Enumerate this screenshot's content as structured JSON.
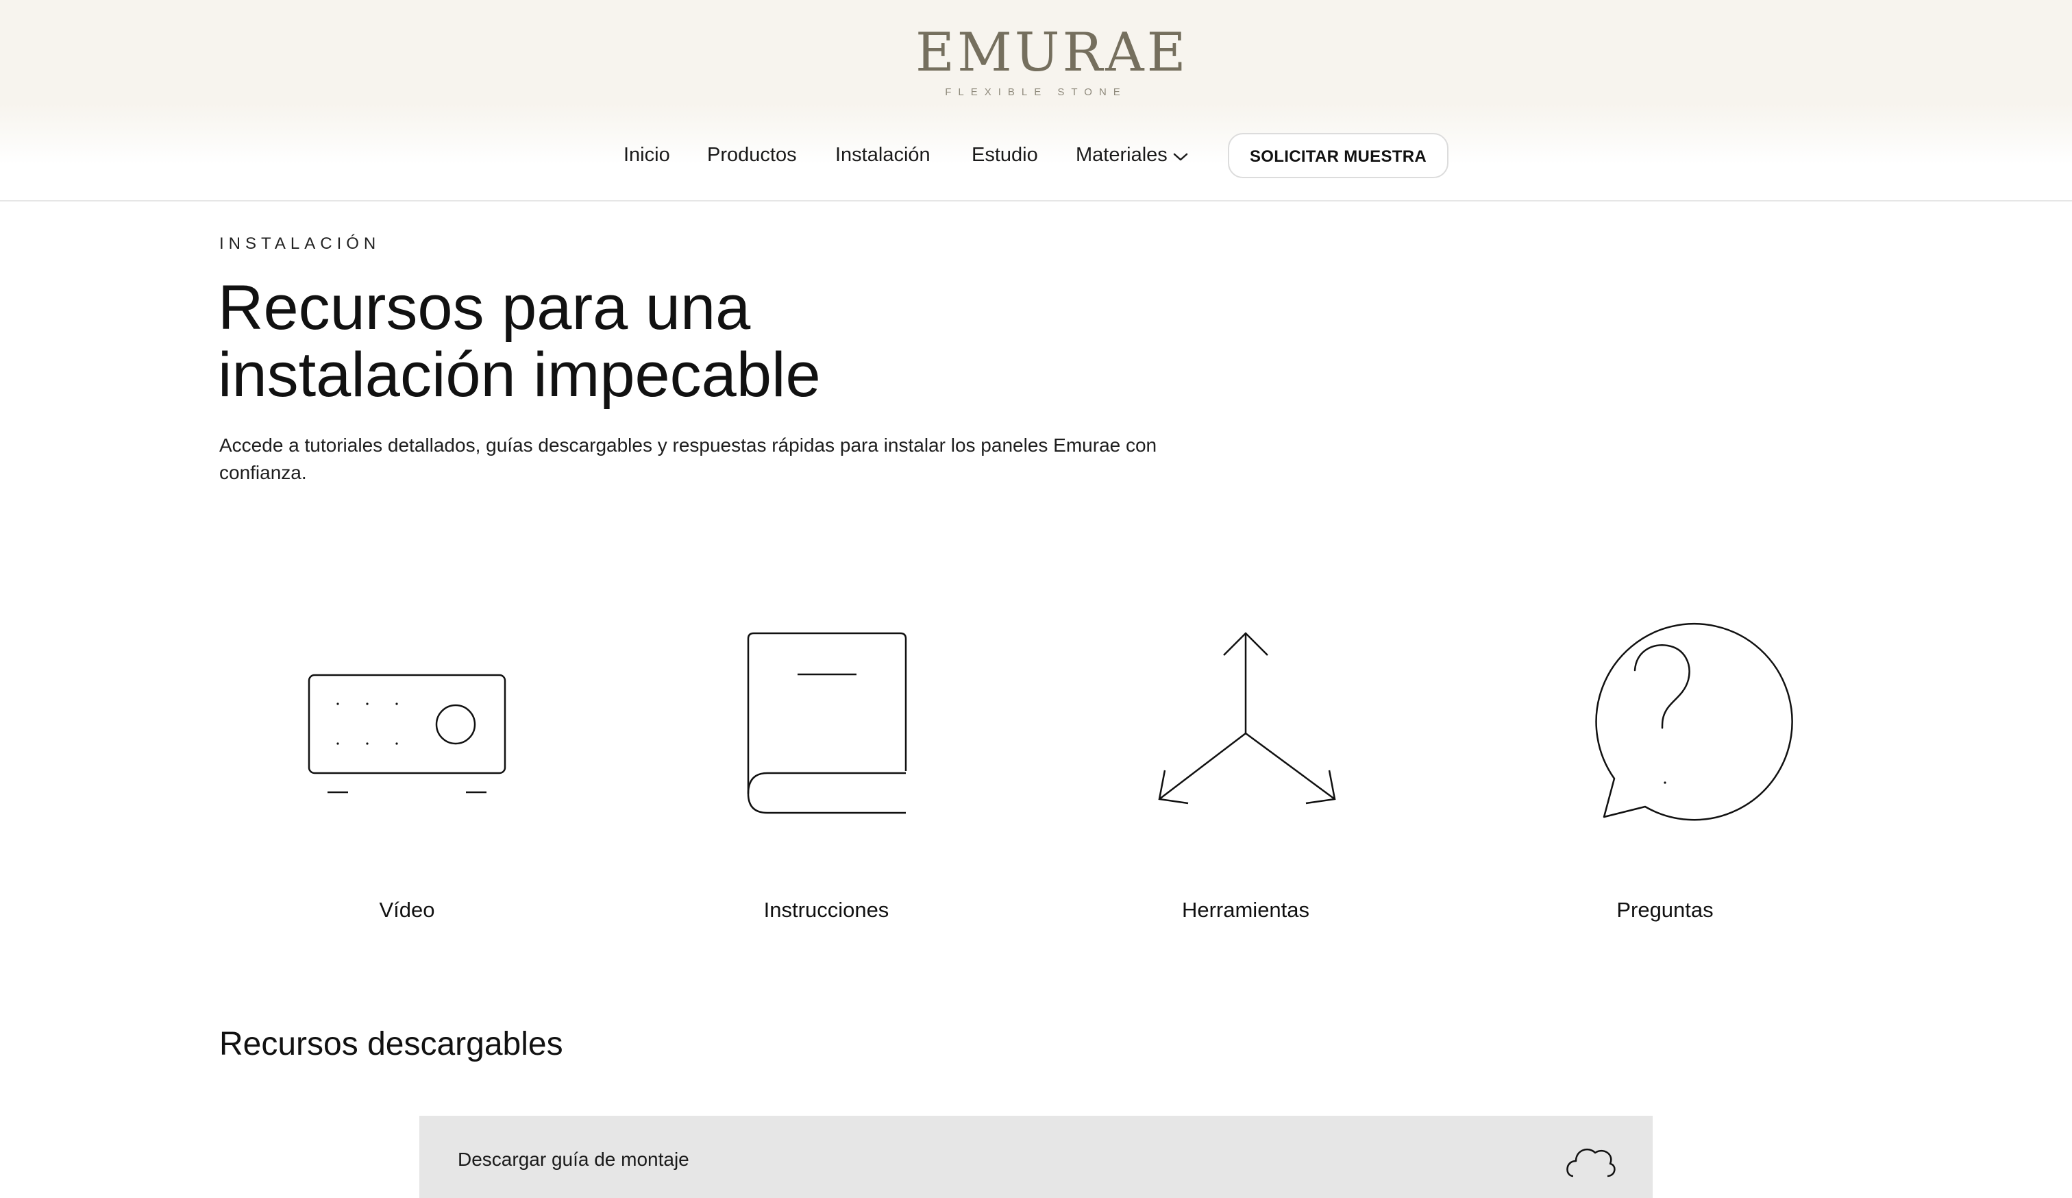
{
  "brand": {
    "name": "EMURAE",
    "tagline": "FLEXIBLE STONE",
    "color": "#756f5e"
  },
  "nav": {
    "items": [
      "Inicio",
      "Productos",
      "Instalación",
      "Estudio",
      "Materiales"
    ],
    "cta_label": "SOLICITAR MUESTRA"
  },
  "hero": {
    "eyebrow": "INSTALACIÓN",
    "title_line1": "Recursos para una",
    "title_line2": "instalación impecable",
    "description": "Accede a tutoriales detallados, guías descargables y respuestas rápidas para instalar los paneles Emurae con confianza."
  },
  "resources": [
    {
      "label": "Vídeo",
      "icon": "video-projector-icon"
    },
    {
      "label": "Instrucciones",
      "icon": "book-icon"
    },
    {
      "label": "Herramientas",
      "icon": "three-arrows-icon"
    },
    {
      "label": "Preguntas",
      "icon": "question-bubble-icon"
    }
  ],
  "downloads": {
    "title": "Recursos descargables",
    "items": [
      {
        "label": "Descargar guía de montaje",
        "icon": "cloud-download-icon"
      }
    ]
  }
}
